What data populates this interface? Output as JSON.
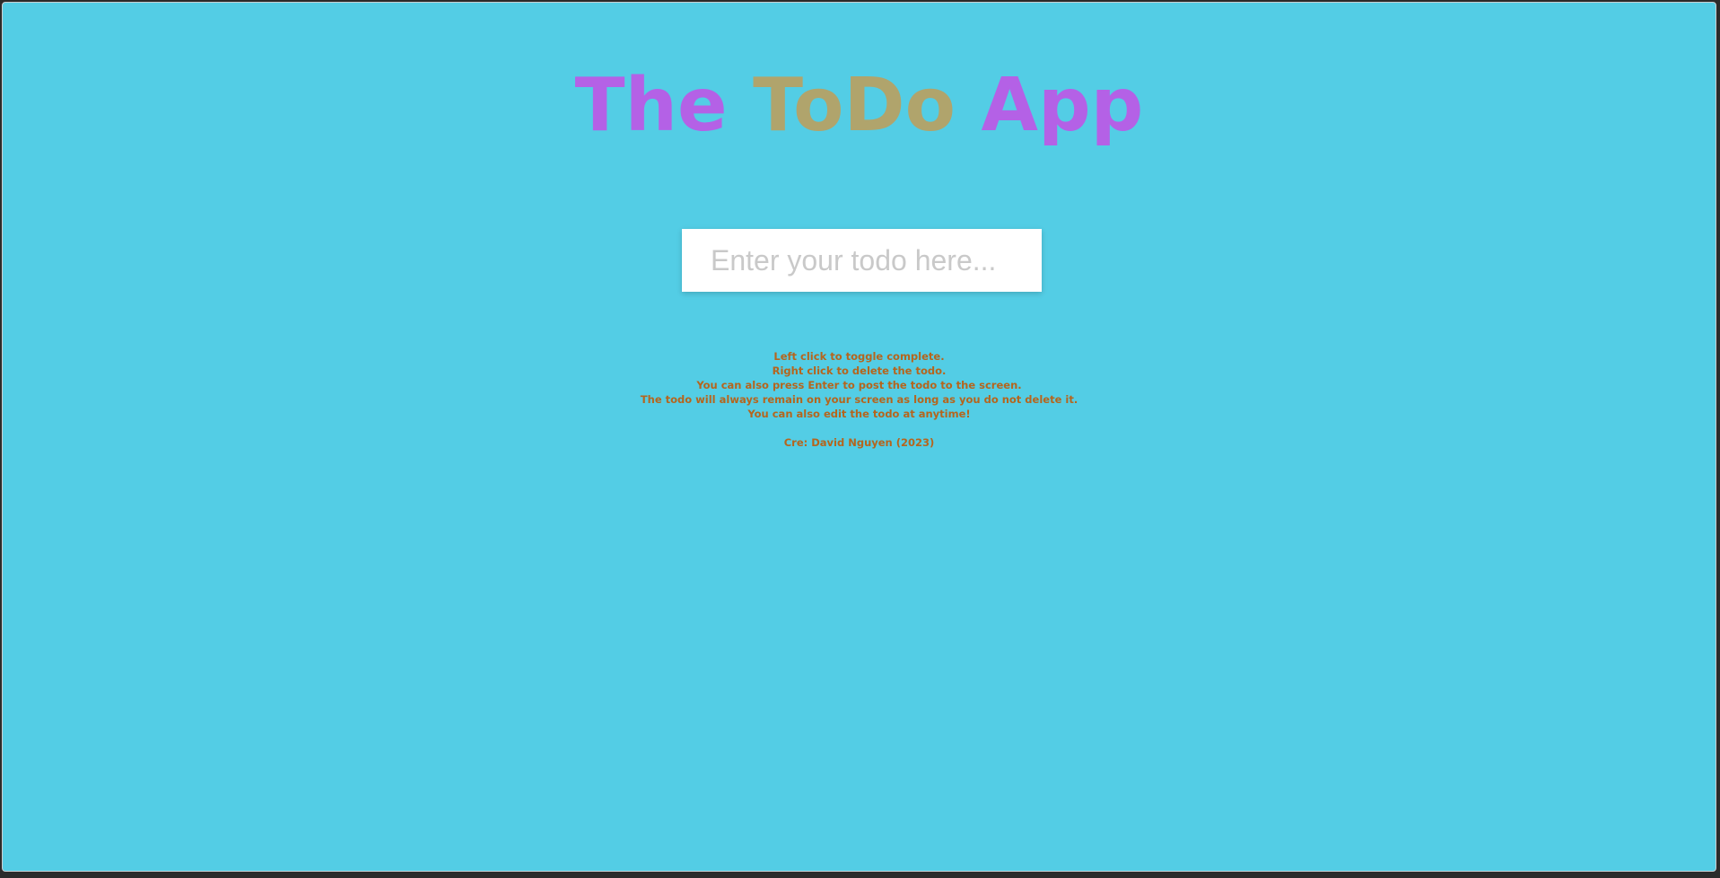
{
  "app": {
    "title_words": [
      "The",
      "ToDo",
      "App"
    ]
  },
  "todo_input": {
    "placeholder": "Enter your todo here...",
    "value": ""
  },
  "instructions": [
    "Left click to toggle complete.",
    "Right click to delete the todo.",
    "You can also press Enter to post the todo to the screen.",
    "The todo will always remain on your screen as long as you do not delete it.",
    "You can also edit the todo at anytime!"
  ],
  "credit": "Cre: David Nguyen (2023)",
  "colors": {
    "background": "#53cde5",
    "title_primary": "#b461e6",
    "title_accent": "#b0a46c",
    "instruction_text": "#b5651d",
    "input_background": "#ffffff",
    "placeholder_text": "#c9c9c9"
  }
}
